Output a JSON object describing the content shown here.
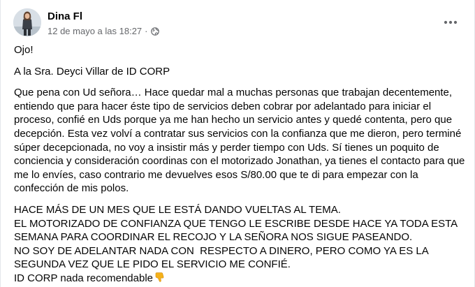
{
  "author": {
    "name": "Dina Fl"
  },
  "post": {
    "timestamp": "12 de mayo a las 18:27",
    "separator": "·",
    "privacy_icon": "globe-icon",
    "more_icon": "more-horizontal-icon",
    "paragraphs": [
      "Ojo!",
      "A la Sra. Deyci Villar de ID CORP",
      "Que pena con Ud señora… Hace quedar mal a muchas personas que trabajan decentemente, entiendo que para hacer éste tipo de servicios deben cobrar por adelantado para iniciar el proceso, confié en Uds porque ya me han hecho un servicio antes y quedé contenta, pero que decepción. Esta vez volví a contratar sus servicios con la confianza que me dieron, pero terminé súper decepcionada, no voy a insistir más y perder tiempo con Uds. Sí tienes un poquito de conciencia y consideración coordinas con el motorizado Jonathan, ya tienes el contacto para que me lo envíes, caso contrario me devuelves esos S/80.00 que te di para empezar con la confección de mis polos.",
      "HACE MÁS DE UN MES QUE LE ESTÁ DANDO VUELTAS AL TEMA.",
      "EL MOTORIZADO DE CONFIANZA QUE TENGO LE ESCRIBE DESDE HACE YA TODA ESTA SEMANA PARA COORDINAR EL RECOJO Y LA SEÑORA NOS SIGUE PASEANDO.",
      "NO SOY DE ADELANTAR NADA CON  RESPECTO A DINERO, PERO COMO YA ES LA SEGUNDA VEZ QUE LE PIDO EL SERVICIO ME CONFIÉ.",
      "ID CORP nada recomendable"
    ],
    "closing_emoji": "thumbs-down-icon"
  },
  "colors": {
    "text": "#050505",
    "secondary_text": "#65676b",
    "emoji": "#f5b21a"
  }
}
